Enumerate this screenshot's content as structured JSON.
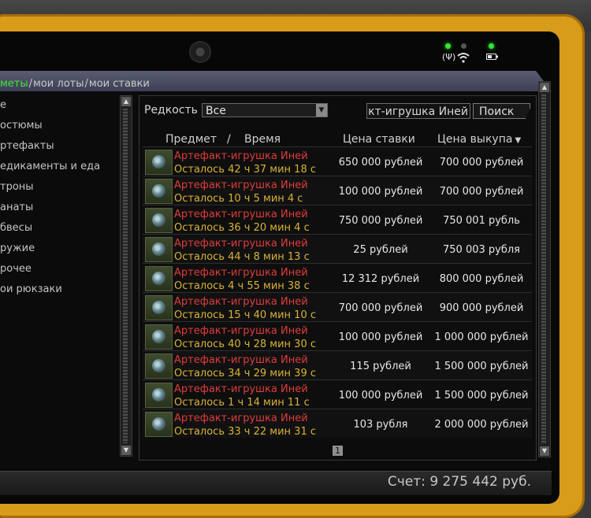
{
  "tabs": {
    "items": [
      "меты",
      "мои лоты",
      "мои ставки"
    ],
    "separator": "/"
  },
  "categories": [
    "е",
    "остюмы",
    "ртефакты",
    "едикаменты и еда",
    "троны",
    "анаты",
    "бвесы",
    "ружие",
    "рочее",
    "ои рюкзаки"
  ],
  "filter": {
    "rarity_label": "Редкость",
    "rarity_value": "Все",
    "search_value": "Артефакт-игрушка Иней",
    "search_button": "Поиск"
  },
  "columns": {
    "item": "Предмет",
    "slash": "/",
    "time": "Время",
    "bid": "Цена ставки",
    "buyout": "Цена выкупа"
  },
  "lots": [
    {
      "name": "Артефакт-игрушка Иней",
      "time": "Осталось 42 ч 37 мин 18 с",
      "bid": "650 000 рублей",
      "buyout": "700 000 рублей"
    },
    {
      "name": "Артефакт-игрушка Иней",
      "time": "Осталось 10 ч 5 мин 4 с",
      "bid": "100 000 рублей",
      "buyout": "700 000 рублей"
    },
    {
      "name": "Артефакт-игрушка Иней",
      "time": "Осталось 36 ч 20 мин 4 с",
      "bid": "750 000 рублей",
      "buyout": "750 001 рубль"
    },
    {
      "name": "Артефакт-игрушка Иней",
      "time": "Осталось 44 ч 8 мин 13 с",
      "bid": "25 рублей",
      "buyout": "750 003 рубля"
    },
    {
      "name": "Артефакт-игрушка Иней",
      "time": "Осталось 4 ч 55 мин 38 с",
      "bid": "12 312 рублей",
      "buyout": "800 000 рублей"
    },
    {
      "name": "Артефакт-игрушка Иней",
      "time": "Осталось 15 ч 40 мин 10 с",
      "bid": "700 000 рублей",
      "buyout": "900 000 рублей"
    },
    {
      "name": "Артефакт-игрушка Иней",
      "time": "Осталось 40 ч 28 мин 30 с",
      "bid": "100 000 рублей",
      "buyout": "1 000 000 рублей"
    },
    {
      "name": "Артефакт-игрушка Иней",
      "time": "Осталось 34 ч 29 мин 39 с",
      "bid": "115 рублей",
      "buyout": "1 500 000 рублей"
    },
    {
      "name": "Артефакт-игрушка Иней",
      "time": "Осталось 1 ч 14 мин 11 с",
      "bid": "100 000 рублей",
      "buyout": "1 500 000 рублей"
    },
    {
      "name": "Артефакт-игрушка Иней",
      "time": "Осталось 33 ч 22 мин 31 с",
      "bid": "103 рубля",
      "buyout": "2 000 000 рублей"
    }
  ],
  "pagination": {
    "current": "1"
  },
  "balance": "Счет: 9 275 442 руб.",
  "colors": {
    "item_name": "#e03c3c",
    "time_left": "#d9b335",
    "active_tab": "#3fe23f",
    "frame": "#d99b1a"
  },
  "icons": [
    "camera-icon",
    "signal-icon",
    "wifi-icon",
    "battery-icon",
    "dropdown-arrow-icon",
    "sort-desc-icon",
    "artifact-icon"
  ]
}
